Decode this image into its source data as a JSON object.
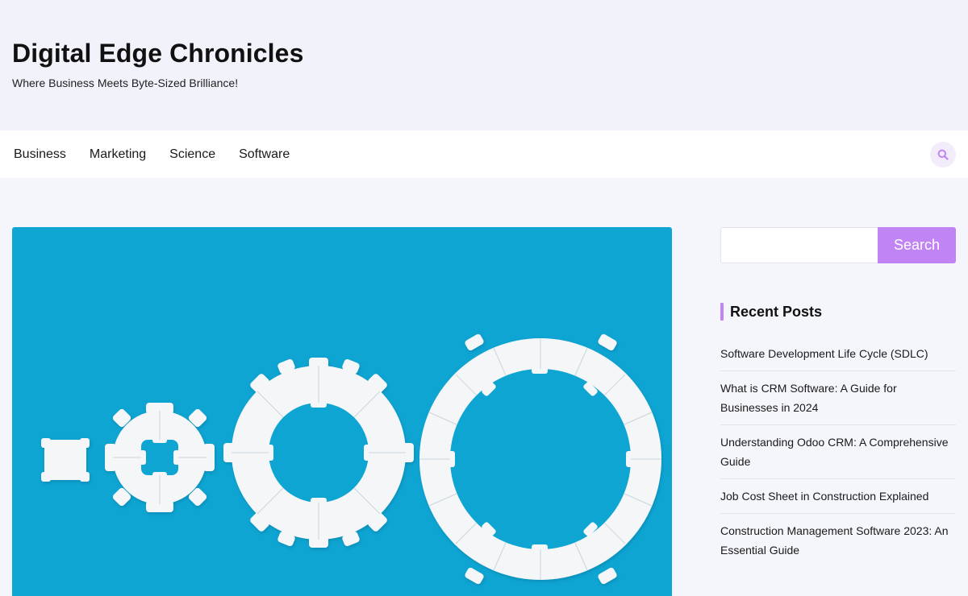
{
  "site": {
    "title": "Digital Edge Chronicles",
    "tagline": "Where Business Meets Byte-Sized Brilliance!"
  },
  "nav": {
    "items": [
      {
        "label": "Business"
      },
      {
        "label": "Marketing"
      },
      {
        "label": "Science"
      },
      {
        "label": "Software"
      }
    ],
    "search_icon": "search-icon"
  },
  "hero": {
    "image_subject": "white puzzle-piece rings on blue background",
    "background_color": "#0ea5d3"
  },
  "sidebar": {
    "search": {
      "placeholder": "",
      "button_label": "Search"
    },
    "recent_posts": {
      "title": "Recent Posts",
      "items": [
        {
          "label": "Software Development Life Cycle (SDLC)"
        },
        {
          "label": "What is CRM Software: A Guide for Businesses in 2024"
        },
        {
          "label": "Understanding Odoo CRM: A Comprehensive Guide"
        },
        {
          "label": "Job Cost Sheet in Construction Explained"
        },
        {
          "label": "Construction Management Software 2023: An Essential Guide"
        }
      ]
    }
  },
  "colors": {
    "accent": "#c084f5",
    "header_bg": "#f2f2fb",
    "page_bg": "#f5f6fb"
  }
}
